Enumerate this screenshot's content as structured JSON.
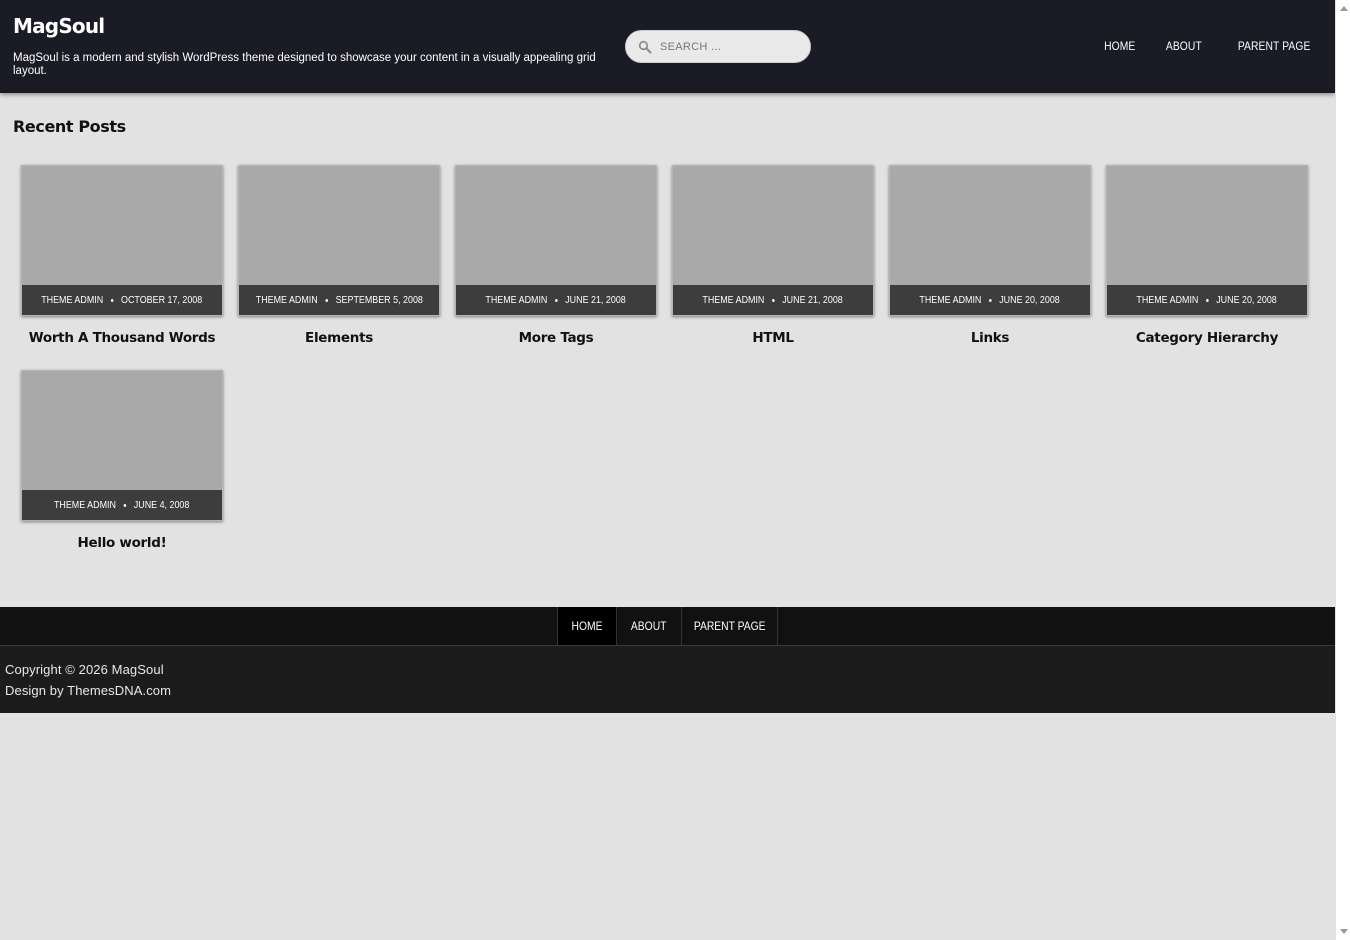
{
  "header": {
    "site_title": "MagSoul",
    "site_description": "MagSoul is a modern and stylish WordPress theme designed to showcase your content in a visually appealing grid layout.",
    "search_placeholder": "SEARCH ...",
    "nav": [
      {
        "label": "HOME"
      },
      {
        "label": "ABOUT"
      },
      {
        "label": "PARENT PAGE"
      }
    ]
  },
  "main": {
    "section_title": "Recent Posts",
    "posts": [
      {
        "author": "THEME ADMIN",
        "date": "OCTOBER 17, 2008",
        "title": "Worth A Thousand Words"
      },
      {
        "author": "THEME ADMIN",
        "date": "SEPTEMBER 5, 2008",
        "title": "Elements"
      },
      {
        "author": "THEME ADMIN",
        "date": "JUNE 21, 2008",
        "title": "More Tags"
      },
      {
        "author": "THEME ADMIN",
        "date": "JUNE 21, 2008",
        "title": "HTML"
      },
      {
        "author": "THEME ADMIN",
        "date": "JUNE 20, 2008",
        "title": "Links"
      },
      {
        "author": "THEME ADMIN",
        "date": "JUNE 20, 2008",
        "title": "Category Hierarchy"
      },
      {
        "author": "THEME ADMIN",
        "date": "JUNE 4, 2008",
        "title": "Hello world!"
      }
    ]
  },
  "footer": {
    "nav": [
      {
        "label": "HOME"
      },
      {
        "label": "ABOUT"
      },
      {
        "label": "PARENT PAGE"
      }
    ],
    "copyright": "Copyright © 2026 MagSoul",
    "credit": "Design by ThemesDNA.com"
  },
  "colors": {
    "header_bg": "#1a1b25",
    "page_bg": "#e2e2e2",
    "thumb_placeholder": "#a9a9a9",
    "meta_bar": "#3d3d3d",
    "footer_nav_bg": "#111111",
    "footer_bg": "#1c1c1c"
  },
  "icons": {
    "search": "search-icon"
  }
}
